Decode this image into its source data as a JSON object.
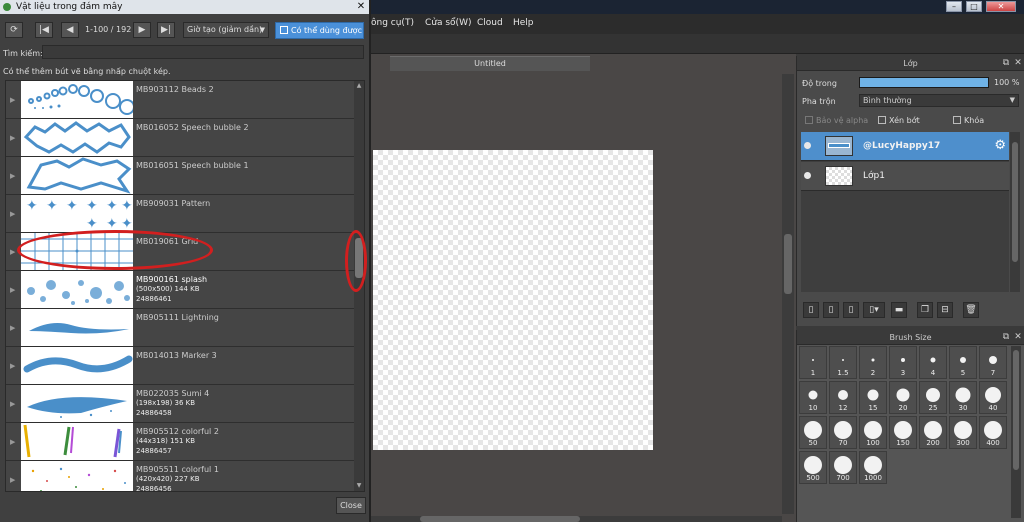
{
  "dialog": {
    "title": "Vật liệu trong đám mây",
    "close_glyph": "✕",
    "nav": {
      "refresh_icon": "refresh-icon",
      "first": "|◀",
      "prev": "◀",
      "next": "▶",
      "last": "▶|"
    },
    "page_info": "1-100 / 192",
    "sort_value": "Giờ tạo (giảm dần)",
    "usable_label": "Có thể dùng được",
    "search_label": "Tìm kiếm:",
    "search_value": "",
    "hint": "Có thể thêm bút vẽ bằng nhấp chuột kép.",
    "close_label": "Close",
    "materials": [
      {
        "name": "MB903112 Beads 2"
      },
      {
        "name": "MB016052 Speech bubble 2"
      },
      {
        "name": "MB016051 Speech bubble 1"
      },
      {
        "name": "MB909031 Pattern"
      },
      {
        "name": "MB019061 Grid"
      },
      {
        "name": "MB900161 splash",
        "size": "(500x500) 144 KB",
        "id": "24886461"
      },
      {
        "name": "MB905111 Lightning"
      },
      {
        "name": "MB014013 Marker 3"
      },
      {
        "name": "MB022035 Sumi 4",
        "size": "(198x198) 36 KB",
        "id": "24886458"
      },
      {
        "name": "MB905512 colorful 2",
        "size": "(44x318) 151 KB",
        "id": "24886457"
      },
      {
        "name": "MB905511 colorful 1",
        "size": "(420x420) 227 KB",
        "id": "24886456"
      }
    ]
  },
  "app": {
    "menu": [
      "ông cụ(T)",
      "Cửa sổ(W)",
      "Cloud",
      "Help"
    ],
    "canvas_tab": "Untitled",
    "window_controls": [
      "–",
      "□",
      "✕"
    ]
  },
  "layer_panel": {
    "title": "Lớp",
    "opacity_label": "Độ trong",
    "opacity_value": "100 %",
    "opacity_fraction": 1.0,
    "blend_label": "Pha trộn",
    "blend_value": "Bình thường",
    "protect_alpha": "Bảo vệ alpha",
    "clipping": "Xén bớt",
    "lock": "Khóa",
    "layers": [
      {
        "name": "@LucyHappy17",
        "selected": true
      },
      {
        "name": "Lớp1",
        "selected": false
      }
    ]
  },
  "brush_panel": {
    "title": "Brush Size",
    "sizes": [
      "1",
      "1.5",
      "2",
      "3",
      "4",
      "5",
      "7",
      "10",
      "12",
      "15",
      "20",
      "25",
      "30",
      "40",
      "50",
      "70",
      "100",
      "150",
      "200",
      "300",
      "400",
      "500",
      "700",
      "1000"
    ]
  },
  "colors": {
    "accent": "#4a90d9",
    "selected_layer": "#4e8fcc",
    "highlight": "#d21f1f",
    "thumb_blue": "#4a8fc9"
  }
}
